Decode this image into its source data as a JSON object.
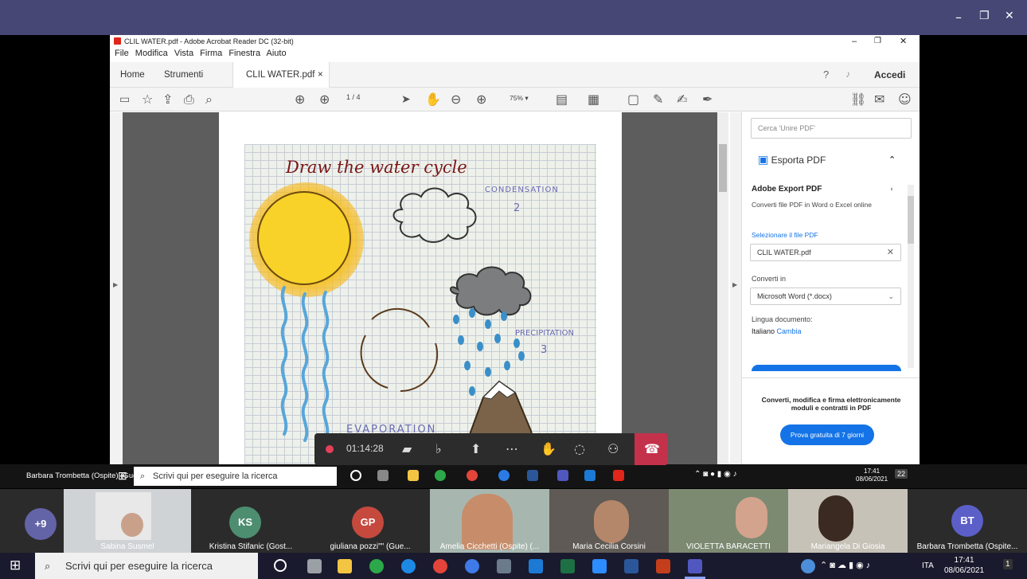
{
  "teams": {
    "minimize": "–",
    "maximize": "❐",
    "close": "✕"
  },
  "acrobat": {
    "title": "CLIL WATER.pdf - Adobe Acrobat Reader DC (32-bit)",
    "menu": [
      "File",
      "Modifica",
      "Vista",
      "Firma",
      "Finestra",
      "Aiuto"
    ],
    "tabs": {
      "home": "Home",
      "tools": "Strumenti",
      "doc": "CLIL WATER.pdf",
      "doc_close": "×"
    },
    "accedi": "Accedi",
    "page_current": "1",
    "page_total": "/ 4",
    "zoom": "75%",
    "drawing": {
      "title": "Draw the water cycle",
      "condensation": "CONDENSATION",
      "num2": "2",
      "precipitation": "PRECIPITATION",
      "num3": "3",
      "evaporation": "EVAPORATION"
    },
    "right_panel": {
      "search_placeholder": "Cerca 'Unire PDF'",
      "export_label": "Esporta PDF",
      "adobe_export": "Adobe Export PDF",
      "convert_desc": "Converti file PDF in Word o Excel online",
      "select_file": "Selezionare il file PDF",
      "file_name": "CLIL WATER.pdf",
      "convert_in": "Converti in",
      "format": "Microsoft Word (*.docx)",
      "lang_label": "Lingua documento:",
      "lang_value": "Italiano",
      "lang_change": "Cambia",
      "promo": "Converti, modifica e firma elettronicamente moduli e contratti in PDF",
      "trial": "Prova gratuita di 7 giorni"
    }
  },
  "call": {
    "timer": "01:14:28"
  },
  "presenter": "Barbara Trombetta (Ospite) (Guest)",
  "inner_taskbar": {
    "search": "Scrivi qui per eseguire la ricerca",
    "time": "17:41",
    "date": "08/06/2021",
    "notif": "22"
  },
  "participants": [
    {
      "initials": "+9",
      "name": ""
    },
    {
      "initials": "",
      "name": "Sabina Susmel"
    },
    {
      "initials": "KS",
      "name": "Kristina Stifanic (Gost..."
    },
    {
      "initials": "GP",
      "name": "giuliana pozzi\"\" (Gue..."
    },
    {
      "initials": "",
      "name": "Amelia Cicchetti (Ospite) (..."
    },
    {
      "initials": "",
      "name": "Maria Cecilia Corsini"
    },
    {
      "initials": "",
      "name": "VIOLETTA BARACETTI"
    },
    {
      "initials": "",
      "name": "Mariangela Di Giosia"
    },
    {
      "initials": "BT",
      "name": "Barbara Trombetta (Ospite..."
    }
  ],
  "taskbar": {
    "search": "Scrivi qui per eseguire la ricerca",
    "lang": "ITA",
    "time": "17:41",
    "date": "08/06/2021",
    "notif": "1"
  },
  "colors": {
    "teams_purple": "#464775",
    "hangup": "#c4314b",
    "adobe_blue": "#1473e6",
    "record": "#e3405a"
  }
}
